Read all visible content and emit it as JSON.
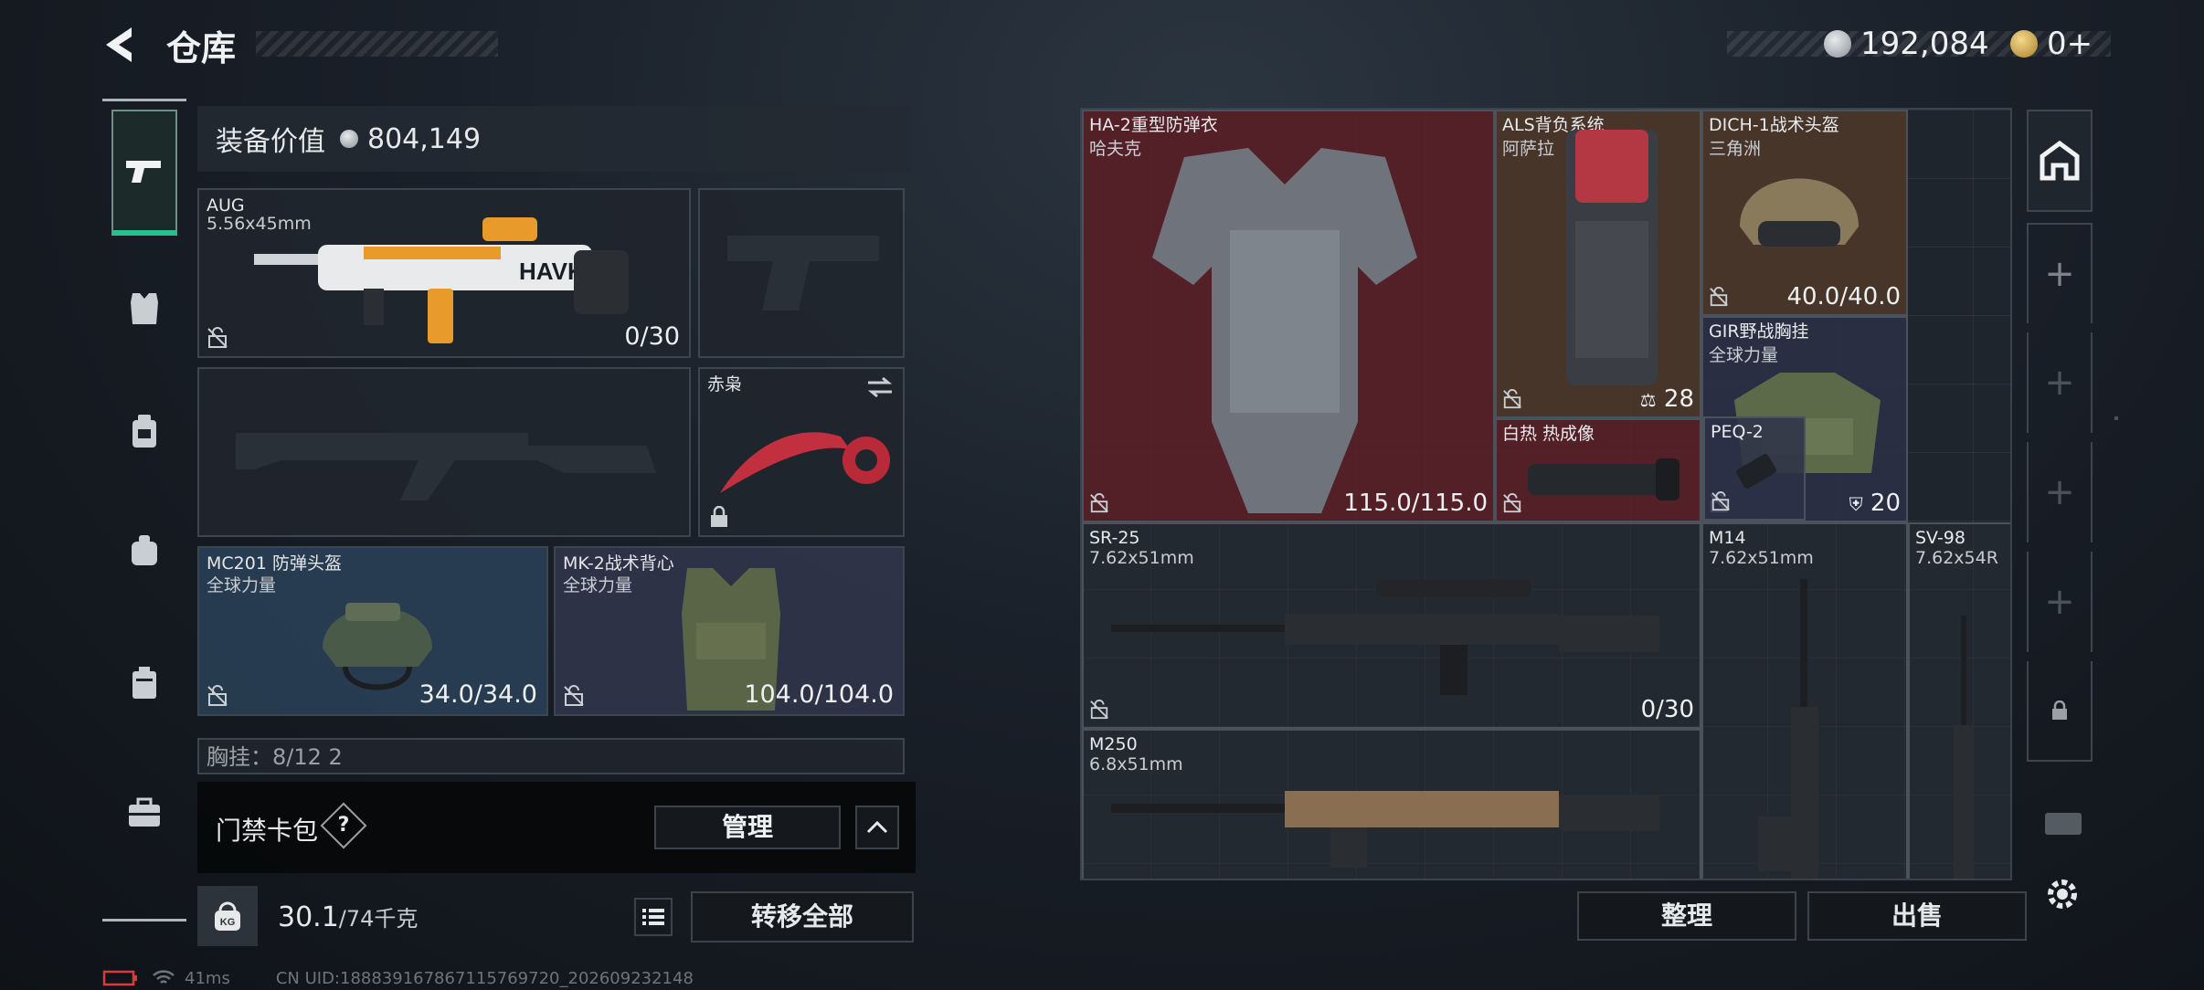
{
  "header": {
    "title": "仓库"
  },
  "currency": {
    "silver": "192,084",
    "gold": "0+"
  },
  "left_nav": {
    "items": [
      "pistol-icon",
      "armor-vest-icon",
      "backpack-pouch-icon",
      "backpack-icon",
      "case-icon",
      "toolbox-icon"
    ]
  },
  "loadout": {
    "equip_value_label": "装备价值",
    "equip_value": "804,149",
    "primary": {
      "name": "AUG",
      "caliber": "5.56x45mm",
      "ammo": "0/30"
    },
    "melee": {
      "name": "赤枭"
    },
    "helmet": {
      "name": "MC201 防弹头盔",
      "brand": "全球力量",
      "durability": "34.0/34.0"
    },
    "vest": {
      "name": "MK-2战术背心",
      "brand": "全球力量",
      "durability": "104.0/104.0"
    },
    "chest_rig_partial": "胸挂：8/12  2",
    "door_card": {
      "label": "门禁卡包",
      "help": "?",
      "manage": "管理"
    },
    "weight": {
      "current": "30.1",
      "capacity": "/74千克",
      "kg_badge": "KG"
    },
    "transfer_all": "转移全部"
  },
  "storage": {
    "items": [
      {
        "name": "HA-2重型防弹衣",
        "brand": "哈夫克",
        "count": "115.0/115.0"
      },
      {
        "name": "ALS背负系统",
        "brand": "阿萨拉",
        "count": "28"
      },
      {
        "name": "DICH-1战术头盔",
        "brand": "三角洲",
        "count": "40.0/40.0"
      },
      {
        "name": "GIR野战胸挂",
        "brand": "全球力量",
        "count": "20"
      },
      {
        "name": "白热 热成像"
      },
      {
        "name": "PEQ-2"
      },
      {
        "name": "SR-25",
        "caliber": "7.62x51mm",
        "count": "0/30"
      },
      {
        "name": "M14",
        "caliber": "7.62x51mm"
      },
      {
        "name": "SV-98",
        "caliber": "7.62x54R"
      },
      {
        "name": "M250",
        "caliber": "6.8x51mm"
      }
    ],
    "sort_label": "整理",
    "sell_label": "出售"
  },
  "right_rail": {
    "add": "+",
    "lock": "🔒"
  },
  "status": {
    "ping": "41ms",
    "uid": "CN UID:1888391678671157697​20_202609232148"
  },
  "colors": {
    "accent_green": "#27c28c",
    "red_slot": "#5e2028",
    "gold": "#c9a04a"
  }
}
